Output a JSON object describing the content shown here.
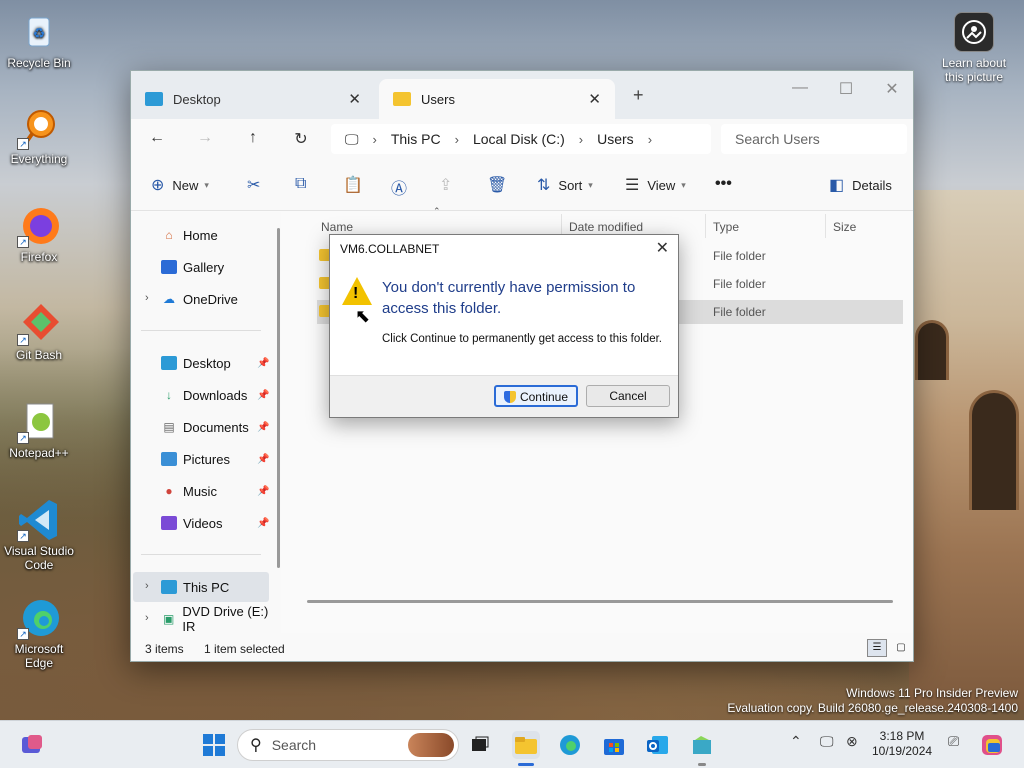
{
  "desktop": {
    "icons": [
      "Recycle Bin",
      "Everything",
      "Firefox",
      "Git Bash",
      "Notepad++",
      "Visual Studio Code",
      "Microsoft Edge"
    ],
    "learn": "Learn about this picture"
  },
  "explorer": {
    "tabs": [
      {
        "label": "Desktop"
      },
      {
        "label": "Users"
      }
    ],
    "breadcrumb": [
      "This PC",
      "Local Disk (C:)",
      "Users"
    ],
    "search_placeholder": "Search Users",
    "commands": {
      "new": "New",
      "sort": "Sort",
      "view": "View"
    },
    "nav": {
      "home": "Home",
      "gallery": "Gallery",
      "onedrive": "OneDrive",
      "quick": [
        "Desktop",
        "Downloads",
        "Documents",
        "Pictures",
        "Music",
        "Videos"
      ],
      "thispc": "This PC",
      "dvd": "DVD Drive (E:) IR"
    },
    "columns": [
      "Name",
      "Date modified",
      "Type",
      "Size"
    ],
    "rows": [
      {
        "type": "File folder"
      },
      {
        "type": "File folder"
      },
      {
        "type": "File folder"
      }
    ],
    "status": {
      "count": "3 items",
      "selected": "1 item selected"
    }
  },
  "dialog": {
    "title": "VM6.COLLABNET",
    "heading": "You don't currently have permission to access this folder.",
    "body": "Click Continue to permanently get access to this folder.",
    "continue": "Continue",
    "cancel": "Cancel"
  },
  "watermark": {
    "line1": "Windows 11 Pro Insider Preview",
    "line2": "Evaluation copy. Build 26080.ge_release.240308-1400"
  },
  "taskbar": {
    "search": "Search",
    "time": "3:18 PM",
    "date": "10/19/2024"
  },
  "colors": {
    "accent": "#2b6bd6",
    "folder": "#f4c430",
    "warning": "#f2c200"
  }
}
